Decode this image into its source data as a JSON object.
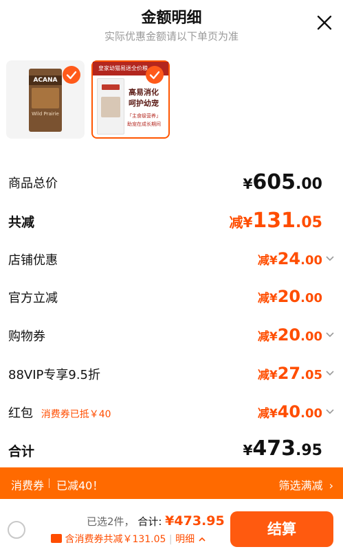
{
  "header": {
    "title": "金额明细",
    "subtitle": "实际优惠金额请以下单页为准"
  },
  "products": [
    {
      "brand": "ACANA",
      "subtitle": "Wild Prairie"
    },
    {
      "banner": "皇家幼猫易迷全价粮",
      "headline_1": "高易消化",
      "headline_2": "呵护幼宠",
      "tag_1": "「主食级营养」",
      "tag_2": "助宠在成长期间"
    }
  ],
  "summary": {
    "total_price_label": "商品总价",
    "total_price_symbol": "¥",
    "total_price_int": "605",
    "total_price_dec": ".00",
    "reduction_label": "共减",
    "reduction_prefix": "减¥",
    "reduction_int": "131",
    "reduction_dec": ".05",
    "items": [
      {
        "label": "店铺优惠",
        "prefix": "减¥",
        "int": "24",
        "dec": ".00",
        "has_chevron": true
      },
      {
        "label": "官方立减",
        "prefix": "减¥",
        "int": "20",
        "dec": ".00",
        "has_chevron": false
      },
      {
        "label": "购物券",
        "prefix": "减¥",
        "int": "20",
        "dec": ".00",
        "has_chevron": true
      },
      {
        "label": "88VIP专享9.5折",
        "prefix": "减¥",
        "int": "27",
        "dec": ".05",
        "has_chevron": true
      },
      {
        "label": "红包",
        "sublabel": "消费券已抵￥40",
        "prefix": "减¥",
        "int": "40",
        "dec": ".00",
        "has_chevron": true
      }
    ],
    "sum_label": "合计",
    "sum_symbol": "¥",
    "sum_int": "473",
    "sum_dec": ".95"
  },
  "banner": {
    "left_1": "消费券",
    "left_2": "已减40！",
    "right": "筛选满减",
    "chevron": "›"
  },
  "footer": {
    "selected": "已选2件，",
    "total_label": "合计:",
    "total_value": "¥473.95",
    "coupon_text": "含消费券共减￥131.05",
    "detail": "明细",
    "checkout": "结算"
  },
  "colors": {
    "accent": "#ff4d00",
    "banner": "#ff6a00",
    "checkout": "#ff5a0f"
  }
}
